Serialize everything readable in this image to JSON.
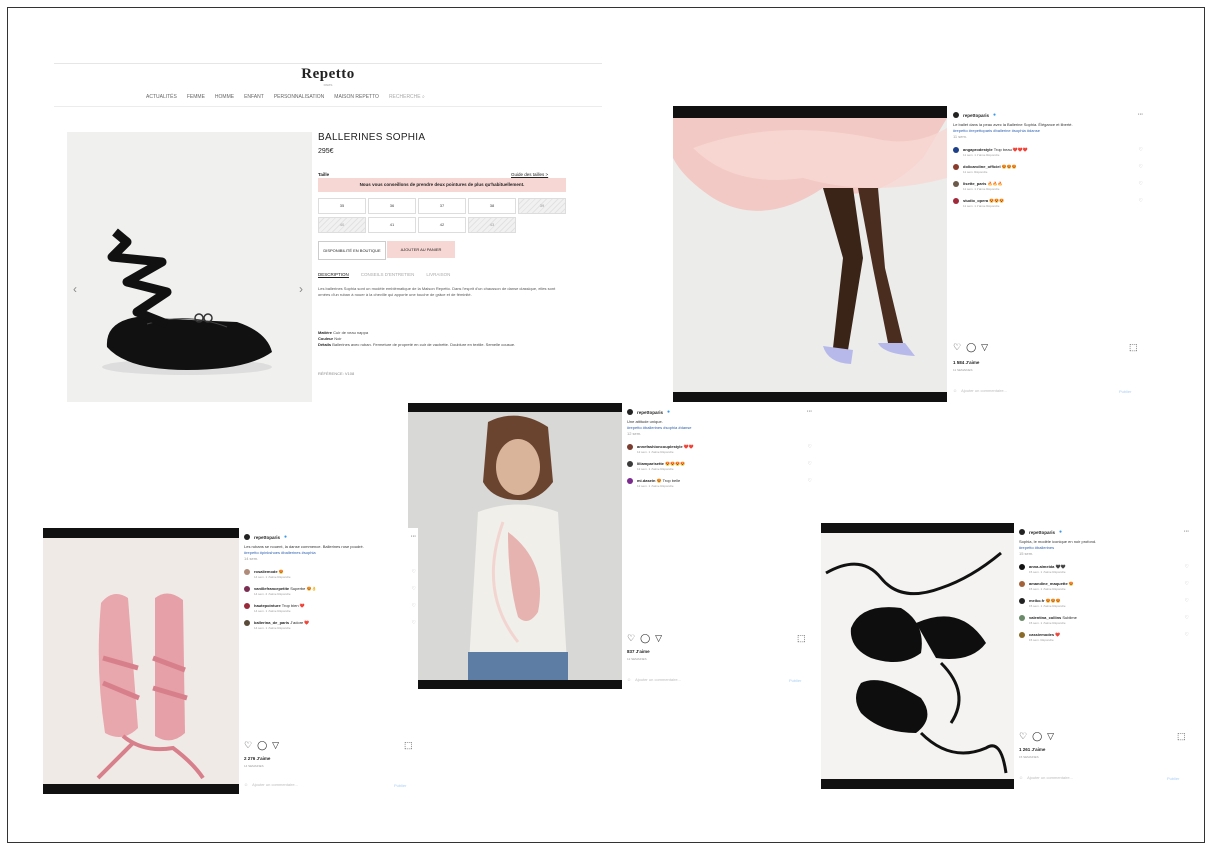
{
  "site": {
    "logo": "Repetto",
    "logo_sub": "PARIS",
    "nav": [
      "ACTUALITÉS",
      "FEMME",
      "HOMME",
      "ENFANT",
      "PERSONNALISATION",
      "MAISON REPETTO"
    ],
    "search_label": "RECHERCHE",
    "product": {
      "name": "BALLERINES SOPHIA",
      "price": "295€",
      "size_label": "Taille",
      "size_guide": "Guide des tailles >",
      "advice": "Nous vous conseillons de prendre deux pointures de plus qu'habituellement.",
      "sizes": [
        "35",
        "36",
        "37",
        "38",
        "39",
        "40",
        "41",
        "42",
        "43"
      ],
      "sizes_out": [
        "39",
        "40",
        "43"
      ],
      "btn_store": "DISPONIBILITÉ EN BOUTIQUE",
      "btn_cart": "AJOUTER AU PANIER",
      "tabs": [
        "DESCRIPTION",
        "CONSEILS D'ENTRETIEN",
        "LIVRAISON"
      ],
      "description": "Les ballerines Sophia sont un modèle emblématique de la Maison Repetto. Dans l'esprit d'un chausson de danse classique, elles sont ornées d'un ruban à nouer à la cheville qui apporte une touche de grâce et de féminité.",
      "specs": [
        {
          "k": "Matière",
          "v": "Cuir de veau nappa"
        },
        {
          "k": "Couleur",
          "v": "Noir"
        },
        {
          "k": "Détails",
          "v": "Ballerines avec ruban. Fermeture de propreté en cuir de vachette. Doublure en textile. Semelle cousue."
        }
      ],
      "ref": "RÉFÉRENCE: V108"
    }
  },
  "posts": [
    {
      "account": "repettoparis",
      "caption": "Le ballet dans la peau avec la Ballerine Sophia. Élégance et liberté.",
      "tags": "#repetto #repettoparis #ballerine #sophia #danse",
      "time": "11 sem.",
      "comments": [
        {
          "user": "angaprodestyle",
          "text": "Trop beau ❤️❤️❤️",
          "meta": "11 sem.  1 J'aime  Répondre"
        },
        {
          "user": "dolicaroline_officiel",
          "text": "😍😍😍",
          "meta": "11 sem.  Répondre"
        },
        {
          "user": "lisette_paris",
          "text": "🔥🔥🔥",
          "meta": "11 sem.  1 J'aime  Répondre"
        },
        {
          "user": "studio_opera",
          "text": "😍😍😍",
          "meta": "11 sem.  1 J'aime  Répondre"
        }
      ],
      "likes": "1 584 J'aime",
      "date": "11 SEMAINES",
      "add_comment": "Ajouter un commentaire...",
      "publish": "Publier"
    },
    {
      "account": "repettoparis",
      "caption": "Une attitude unique.",
      "tags": "#repetto #ballerines #sophia #danse",
      "time": "12 sem.",
      "comments": [
        {
          "user": "annefashioncouplestyle",
          "text": "❤️❤️",
          "meta": "12 sem.  1 J'aime  Répondre"
        },
        {
          "user": "liliamparisette",
          "text": "😍😍😍😍",
          "meta": "12 sem.  1 J'aime  Répondre"
        },
        {
          "user": "mi.dasein",
          "text": "😍 Trop belle",
          "meta": "12 sem.  1 J'aime  Répondre"
        }
      ],
      "likes": "837 J'aime",
      "date": "12 SEMAINES",
      "add_comment": "Ajouter un commentaire...",
      "publish": "Publier"
    },
    {
      "account": "repettoparis",
      "caption": "Les rubans se nouent, la danse commence. Ballerines rose poudré.",
      "tags": "#repetto #pinkshoes #ballerines #sophia",
      "time": "14 sem.",
      "comments": [
        {
          "user": "rosaliemode",
          "text": "😍",
          "meta": "14 sem.  1 J'aime  Répondre"
        },
        {
          "user": "vanillefrancepetite",
          "text": "Superbe 😍👌",
          "meta": "14 sem.  2 J'aime  Répondre"
        },
        {
          "user": "hautepointure",
          "text": "Trop bien ❤️",
          "meta": "14 sem.  1 J'aime  Répondre"
        },
        {
          "user": "ballerina_de_paris",
          "text": "J'adore ❤️",
          "meta": "14 sem.  1 J'aime  Répondre"
        }
      ],
      "likes": "2 276 J'aime",
      "date": "14 SEMAINES",
      "add_comment": "Ajouter un commentaire...",
      "publish": "Publier"
    },
    {
      "account": "repettoparis",
      "caption": "Sophia, le modèle iconique en noir profond.",
      "tags": "#repetto #ballerines",
      "time": "15 sem.",
      "comments": [
        {
          "user": "anna.almeida",
          "text": "🖤🖤",
          "meta": "15 sem.  1 J'aime  Répondre"
        },
        {
          "user": "amandine_maquette",
          "text": "😍",
          "meta": "15 sem.  1 J'aime  Répondre"
        },
        {
          "user": "meiko.fr",
          "text": "😍😍😍",
          "meta": "15 sem.  1 J'aime  Répondre"
        },
        {
          "user": "valentina_collins",
          "text": "Sublime",
          "meta": "15 sem.  1 J'aime  Répondre"
        },
        {
          "user": "cassiemodes",
          "text": "❤️",
          "meta": "15 sem.  Répondre"
        }
      ],
      "likes": "1 261 J'aime",
      "date": "15 SEMAINES",
      "add_comment": "Ajouter un commentaire...",
      "publish": "Publier"
    }
  ],
  "icons": {
    "heart": "♡",
    "comment": "◯",
    "share": "▽",
    "bookmark": "⬚",
    "arrow_left": "‹",
    "arrow_right": "›",
    "search": "⌕",
    "more": "···",
    "verified": "●"
  },
  "colors": {
    "accent_pink": "#f6d7d4",
    "link_blue": "#2a5db0",
    "verified_blue": "#3897f0"
  }
}
